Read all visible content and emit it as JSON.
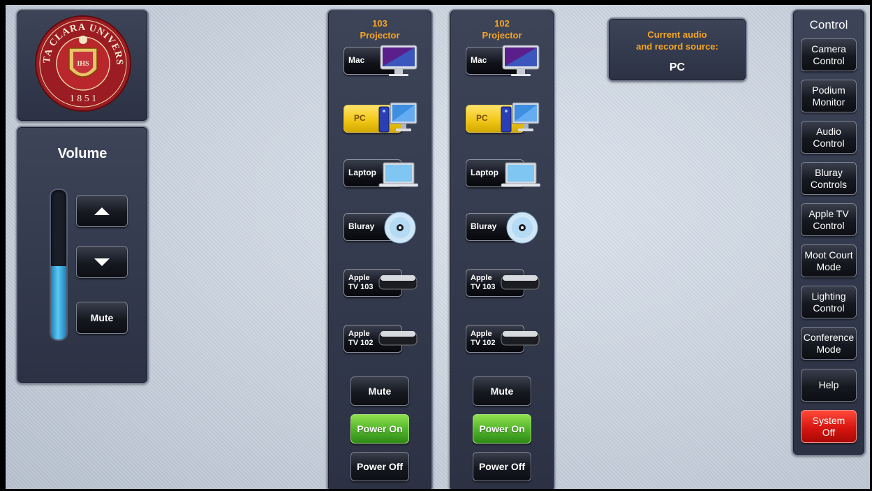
{
  "colors": {
    "accent_orange": "#f5a623",
    "active_yellow": "#f2c818",
    "power_green": "#4fb22a",
    "off_red": "#d81510",
    "volume_blue": "#5cc8f5"
  },
  "logo": {
    "name_text": "SANTA CLARA UNIVERSITY",
    "year": "1 8 5 1",
    "monogram": "IHS"
  },
  "volume": {
    "title": "Volume",
    "level": 0.49,
    "up_icon": "arrow-up-icon",
    "down_icon": "arrow-down-icon",
    "mute_label": "Mute"
  },
  "projectors": [
    {
      "title_line1": "103",
      "title_line2": "Projector",
      "sources": [
        {
          "label": "Mac",
          "icon": "imac-icon",
          "active": false
        },
        {
          "label": "PC",
          "icon": "pc-icon",
          "active": true
        },
        {
          "label": "Laptop",
          "icon": "laptop-icon",
          "active": false
        },
        {
          "label": "Bluray",
          "icon": "disc-icon",
          "active": false
        },
        {
          "label": "Apple TV 103",
          "icon": "apple-tv-icon",
          "active": false
        },
        {
          "label": "Apple TV 102",
          "icon": "apple-tv-icon",
          "active": false
        }
      ],
      "mute_label": "Mute",
      "power_on_label": "Power On",
      "power_off_label": "Power Off"
    },
    {
      "title_line1": "102",
      "title_line2": "Projector",
      "sources": [
        {
          "label": "Mac",
          "icon": "imac-icon",
          "active": false
        },
        {
          "label": "PC",
          "icon": "pc-icon",
          "active": true
        },
        {
          "label": "Laptop",
          "icon": "laptop-icon",
          "active": false
        },
        {
          "label": "Bluray",
          "icon": "disc-icon",
          "active": false
        },
        {
          "label": "Apple TV 103",
          "icon": "apple-tv-icon",
          "active": false
        },
        {
          "label": "Apple TV 102",
          "icon": "apple-tv-icon",
          "active": false
        }
      ],
      "mute_label": "Mute",
      "power_on_label": "Power On",
      "power_off_label": "Power Off"
    }
  ],
  "current_source": {
    "label_line1": "Current audio",
    "label_line2": "and record source:",
    "value": "PC"
  },
  "control": {
    "title": "Control",
    "buttons": [
      {
        "line1": "Camera",
        "line2": "Control"
      },
      {
        "line1": "Podium",
        "line2": "Monitor"
      },
      {
        "line1": "Audio",
        "line2": "Control"
      },
      {
        "line1": "Bluray",
        "line2": "Controls"
      },
      {
        "line1": "Apple TV",
        "line2": "Control"
      },
      {
        "line1": "Moot Court",
        "line2": "Mode"
      },
      {
        "line1": "Lighting",
        "line2": "Control"
      },
      {
        "line1": "Conference",
        "line2": "Mode"
      },
      {
        "line1": "Help",
        "line2": ""
      },
      {
        "line1": "System",
        "line2": "Off"
      }
    ]
  }
}
